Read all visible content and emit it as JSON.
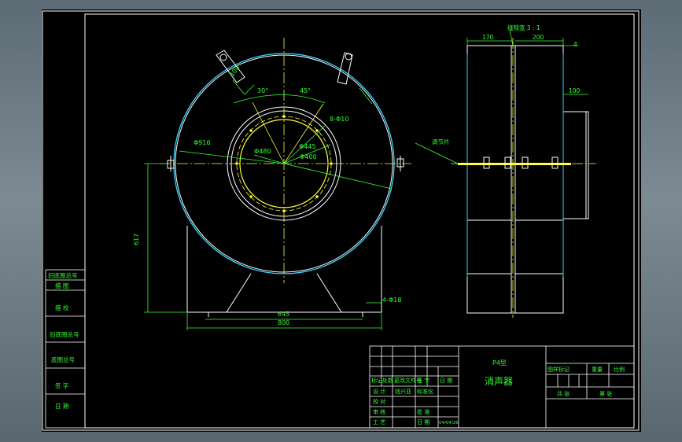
{
  "colors": {
    "background": "#000000",
    "frame": "#ffffff",
    "dimension": "#33ff33",
    "centerline": "#ffff33",
    "casing": "#33d6ff",
    "window": "#6e7c86"
  },
  "front_view": {
    "dims": {
      "d_outer": "Φ916",
      "d_480": "Φ480",
      "d_445": "Φ445",
      "d_400": "Φ400",
      "holes": "8-Φ10",
      "height": "617",
      "base_inner": "645",
      "base_outer": "800",
      "foot_holes": "4-Φ18",
      "angle_left": "30°",
      "angle_right": "45°",
      "lug_width": "100"
    }
  },
  "side_view": {
    "dims": {
      "top_left": "170",
      "top_right": "200",
      "thickness": "4",
      "flange": "100",
      "gap_note": "缝隙宽 3 : 1",
      "gasket_note": "调节片"
    }
  },
  "left_strip": {
    "cells": [
      "旧底图总号",
      "描 图",
      "描 校",
      "旧底图总号",
      "底图总号",
      "签 字",
      "日 期"
    ]
  },
  "title_block": {
    "part_code": "P4型",
    "part_name": "消声器",
    "rev_header": [
      "标记",
      "处数",
      "更改文件号",
      "签 字",
      "日 期"
    ],
    "row_labels": [
      "设 计",
      "校 对",
      "审 核",
      "工 艺"
    ],
    "designer": "钱兴亚",
    "std_check": "标准化",
    "approve": "批 准",
    "date_label": "日 期",
    "date_value": "04/04/26",
    "mark_label": "图样标记",
    "weight_label": "重量",
    "scale_label": "比例",
    "sheets_total": "共 张",
    "sheet_no": "第 张"
  }
}
